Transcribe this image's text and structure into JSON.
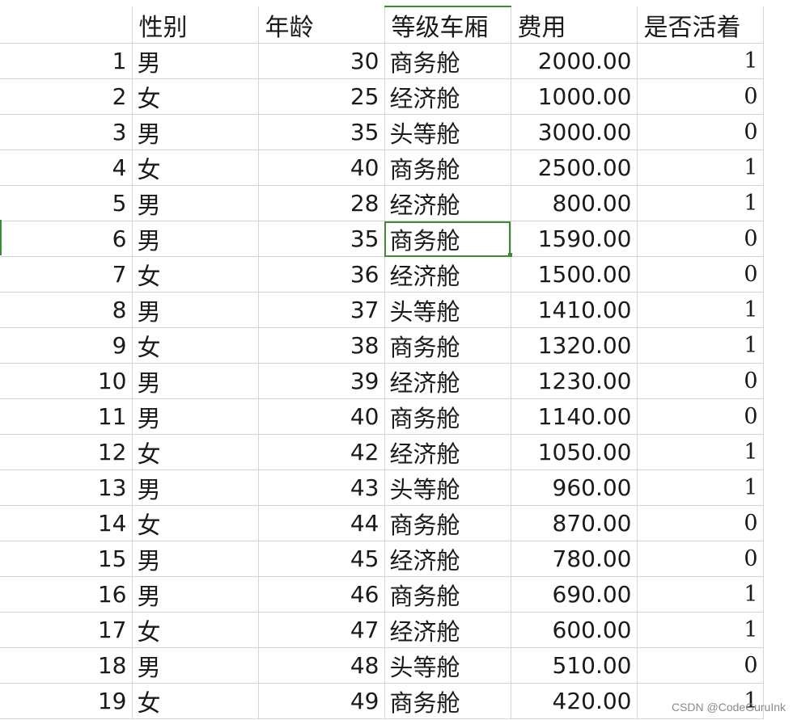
{
  "headers": [
    "",
    "性别",
    "年龄",
    "等级车厢",
    "费用",
    "是否活着"
  ],
  "rows": [
    {
      "num": "1",
      "gender": "男",
      "age": "30",
      "class": "商务舱",
      "fee": "2000.00",
      "survived": "1"
    },
    {
      "num": "2",
      "gender": "女",
      "age": "25",
      "class": "经济舱",
      "fee": "1000.00",
      "survived": "0"
    },
    {
      "num": "3",
      "gender": "男",
      "age": "35",
      "class": "头等舱",
      "fee": "3000.00",
      "survived": "0"
    },
    {
      "num": "4",
      "gender": "女",
      "age": "40",
      "class": "商务舱",
      "fee": "2500.00",
      "survived": "1"
    },
    {
      "num": "5",
      "gender": "男",
      "age": "28",
      "class": "经济舱",
      "fee": "800.00",
      "survived": "1"
    },
    {
      "num": "6",
      "gender": "男",
      "age": "35",
      "class": "商务舱",
      "fee": "1590.00",
      "survived": "0"
    },
    {
      "num": "7",
      "gender": "女",
      "age": "36",
      "class": "经济舱",
      "fee": "1500.00",
      "survived": "0"
    },
    {
      "num": "8",
      "gender": "男",
      "age": "37",
      "class": "头等舱",
      "fee": "1410.00",
      "survived": "1"
    },
    {
      "num": "9",
      "gender": "女",
      "age": "38",
      "class": "商务舱",
      "fee": "1320.00",
      "survived": "1"
    },
    {
      "num": "10",
      "gender": "男",
      "age": "39",
      "class": "经济舱",
      "fee": "1230.00",
      "survived": "0"
    },
    {
      "num": "11",
      "gender": "男",
      "age": "40",
      "class": "商务舱",
      "fee": "1140.00",
      "survived": "0"
    },
    {
      "num": "12",
      "gender": "女",
      "age": "42",
      "class": "经济舱",
      "fee": "1050.00",
      "survived": "1"
    },
    {
      "num": "13",
      "gender": "男",
      "age": "43",
      "class": "头等舱",
      "fee": "960.00",
      "survived": "1"
    },
    {
      "num": "14",
      "gender": "女",
      "age": "44",
      "class": "商务舱",
      "fee": "870.00",
      "survived": "0"
    },
    {
      "num": "15",
      "gender": "男",
      "age": "45",
      "class": "经济舱",
      "fee": "780.00",
      "survived": "0"
    },
    {
      "num": "16",
      "gender": "男",
      "age": "46",
      "class": "商务舱",
      "fee": "690.00",
      "survived": "1"
    },
    {
      "num": "17",
      "gender": "女",
      "age": "47",
      "class": "经济舱",
      "fee": "600.00",
      "survived": "1"
    },
    {
      "num": "18",
      "gender": "男",
      "age": "48",
      "class": "头等舱",
      "fee": "510.00",
      "survived": "0"
    },
    {
      "num": "19",
      "gender": "女",
      "age": "49",
      "class": "商务舱",
      "fee": "420.00",
      "survived": "1"
    }
  ],
  "selected_row_index": 5,
  "selected_column": "class",
  "watermark": "CSDN @CodeGuruInk",
  "colors": {
    "selection": "#3d8b37",
    "gridline": "#d4d4d4",
    "text": "#1a1a1a"
  }
}
